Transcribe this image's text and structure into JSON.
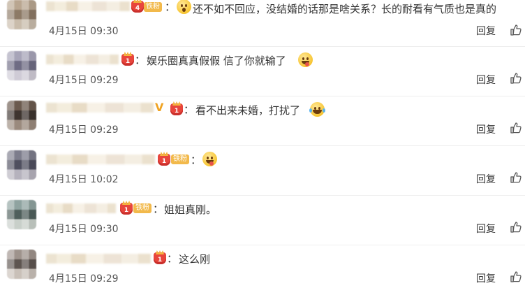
{
  "comments": [
    {
      "text": "还不如不回应，没结婚的话那是啥关系？长的耐看有气质也是真的",
      "time": "4月15日 09:30",
      "reply": "回复",
      "badge": "铁粉",
      "crown_level": "4",
      "emoji": "surprised",
      "avatar_colors": [
        "#b9a690",
        "#8d7a66",
        "#c9bcab"
      ]
    },
    {
      "text": "娱乐圈真真假假 信了你就输了",
      "time": "4月15日 09:29",
      "reply": "回复",
      "emoji": "yum",
      "avatar_colors": [
        "#a7a4b8",
        "#6f6c84",
        "#cfcbd6"
      ]
    },
    {
      "text": "看不出来未婚，打扰了",
      "time": "4月15日 09:29",
      "reply": "回复",
      "emoji": "laugh",
      "avatar_colors": [
        "#6b5a4e",
        "#3e3530",
        "#9a8a7d"
      ]
    },
    {
      "text": "",
      "time": "4月15日 10:02",
      "reply": "回复",
      "badge": "铁粉",
      "emoji": "yum",
      "avatar_colors": [
        "#7d7d8c",
        "#4f4f5f",
        "#b5b2bd"
      ]
    },
    {
      "text": "姐姐真刚。",
      "time": "4月15日 09:30",
      "reply": "回复",
      "badge": "铁粉",
      "avatar_colors": [
        "#8fa3a0",
        "#4f5f5c",
        "#c8cfc9"
      ]
    },
    {
      "text": "这么刚",
      "time": "4月15日 09:29",
      "reply": "回复",
      "avatar_colors": [
        "#9e938c",
        "#5e5550",
        "#c9c0b8"
      ]
    }
  ],
  "colors": {
    "badge": "#f2b94b",
    "crown": "#e8453c",
    "vip": "#f0a322",
    "text": "#333333",
    "meta": "#555555"
  },
  "icons": {
    "like": "thumbs-up-icon",
    "crown": "crown-icon",
    "vip": "vip-v-icon"
  }
}
